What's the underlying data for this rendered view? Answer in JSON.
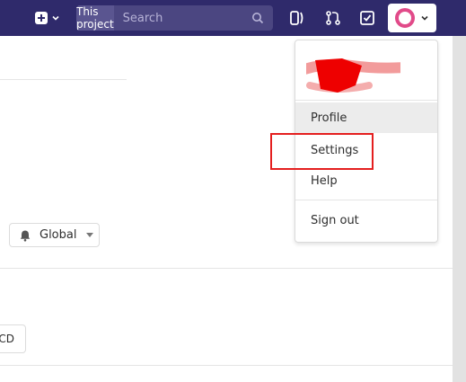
{
  "navbar": {
    "search_scope": "This project",
    "search_placeholder": "Search"
  },
  "notifications": {
    "label": "Global"
  },
  "partial_button": {
    "label": "CD"
  },
  "user_menu": {
    "items": [
      {
        "label": "Profile"
      },
      {
        "label": "Settings"
      },
      {
        "label": "Help"
      },
      {
        "label": "Sign out"
      }
    ]
  },
  "colors": {
    "navbar": "#2f2a6b",
    "avatar_ring": "#e14a89",
    "highlight": "#e41f1f"
  },
  "icons": [
    "plus-square-icon",
    "chevron-down-icon",
    "search-icon",
    "issues-icon",
    "merge-request-icon",
    "todo-icon",
    "bell-icon"
  ]
}
